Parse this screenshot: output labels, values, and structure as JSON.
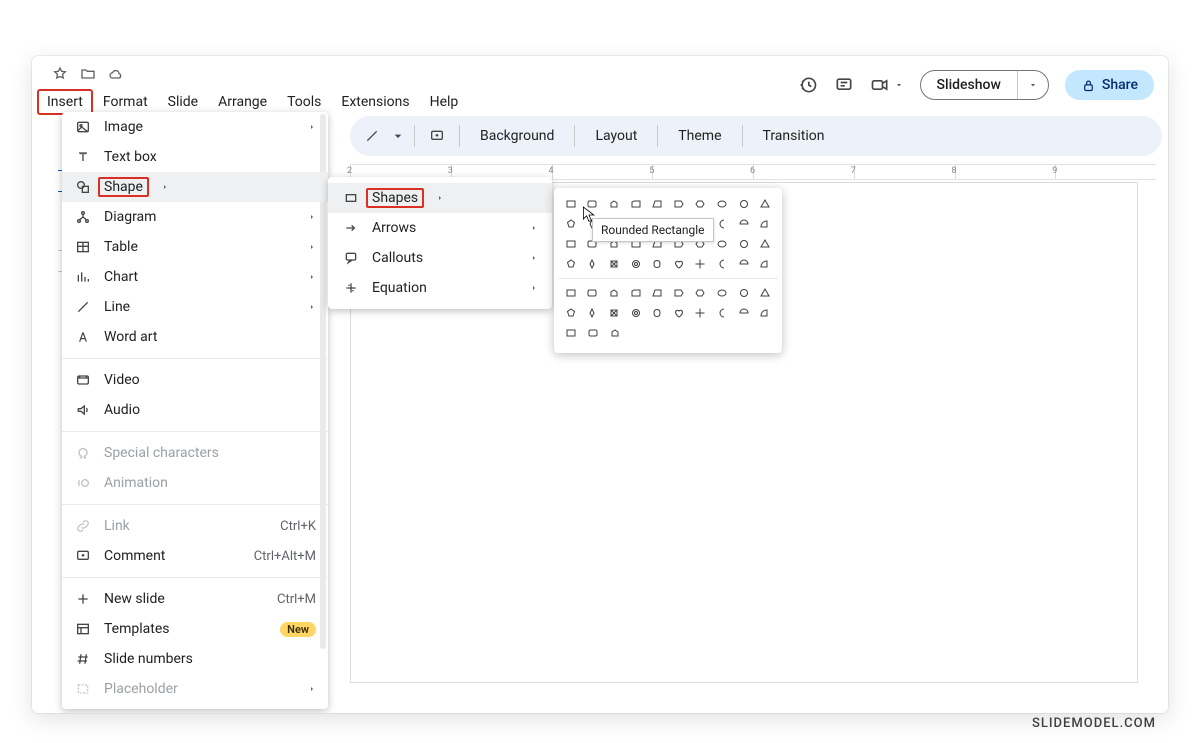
{
  "menubar": [
    "Insert",
    "Format",
    "Slide",
    "Arrange",
    "Tools",
    "Extensions",
    "Help"
  ],
  "menubar_highlight_index": 0,
  "header": {
    "slideshow_label": "Slideshow",
    "share_label": "Share"
  },
  "toolbar": {
    "background": "Background",
    "layout": "Layout",
    "theme": "Theme",
    "transition": "Transition"
  },
  "ruler_marks": [
    "2",
    "3",
    "4",
    "5",
    "6",
    "7",
    "8",
    "9"
  ],
  "insert_menu": {
    "items": [
      {
        "icon": "image-icon",
        "label": "Image",
        "submenu": true
      },
      {
        "icon": "textbox-icon",
        "label": "Text box"
      },
      {
        "icon": "shape-icon",
        "label": "Shape",
        "submenu": true,
        "hover": true,
        "highlight": true
      },
      {
        "icon": "diagram-icon",
        "label": "Diagram",
        "submenu": true
      },
      {
        "icon": "table-icon",
        "label": "Table",
        "submenu": true
      },
      {
        "icon": "chart-icon",
        "label": "Chart",
        "submenu": true
      },
      {
        "icon": "line-icon",
        "label": "Line",
        "submenu": true
      },
      {
        "icon": "wordart-icon",
        "label": "Word art"
      },
      {
        "divider": true
      },
      {
        "icon": "video-icon",
        "label": "Video"
      },
      {
        "icon": "audio-icon",
        "label": "Audio"
      },
      {
        "divider": true
      },
      {
        "icon": "omega-icon",
        "label": "Special characters",
        "disabled": true
      },
      {
        "icon": "motion-icon",
        "label": "Animation",
        "disabled": true
      },
      {
        "divider": true
      },
      {
        "icon": "link-icon",
        "label": "Link",
        "accel": "Ctrl+K",
        "disabled": true
      },
      {
        "icon": "comment-icon",
        "label": "Comment",
        "accel": "Ctrl+Alt+M"
      },
      {
        "divider": true
      },
      {
        "icon": "plus-icon",
        "label": "New slide",
        "accel": "Ctrl+M"
      },
      {
        "icon": "templates-icon",
        "label": "Templates",
        "badge": "New"
      },
      {
        "icon": "hash-icon",
        "label": "Slide numbers"
      },
      {
        "icon": "placeholder-icon",
        "label": "Placeholder",
        "submenu": true,
        "disabled": true
      }
    ]
  },
  "shape_submenu": {
    "items": [
      {
        "icon": "rect-icon",
        "label": "Shapes",
        "submenu": true,
        "hover": true,
        "highlight": true
      },
      {
        "icon": "arrow-icon",
        "label": "Arrows",
        "submenu": true
      },
      {
        "icon": "callout-icon",
        "label": "Callouts",
        "submenu": true
      },
      {
        "icon": "equation-icon",
        "label": "Equation",
        "submenu": true
      }
    ]
  },
  "tooltip": "Rounded Rectangle",
  "watermark": "SLIDEMODEL.COM"
}
